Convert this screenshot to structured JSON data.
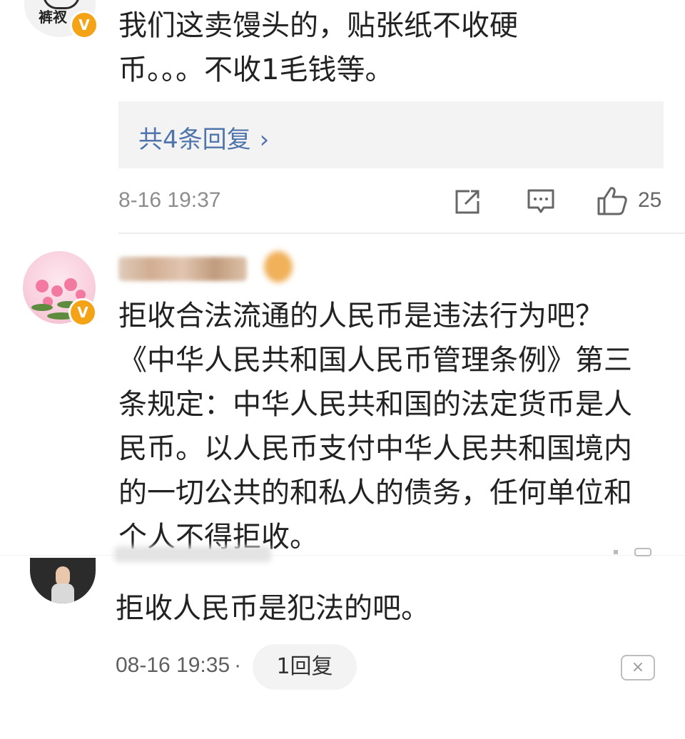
{
  "comment1": {
    "avatar_text": "裤衩",
    "verified": "V",
    "text": "我们这卖馒头的，贴张纸不收硬币。。。不收1毛钱等。",
    "replies_label": "共4条回复",
    "replies_chevron": "›",
    "time": "8-16 19:37",
    "likes": "25",
    "icons": [
      "share-icon",
      "comment-icon",
      "like-icon"
    ]
  },
  "comment2": {
    "verified": "V",
    "text": "拒收合法流通的人民币是违法行为吧？《中华人民共和国人民币管理条例》第三条规定：中华人民共和国的法定货币是人民币。以人民币支付中华人民共和国境内的一切公共的和私人的债务，任何单位和个人不得拒收。"
  },
  "comment3": {
    "text": "拒收人民币是犯法的吧。",
    "time": "08-16 19:35",
    "separator": "·",
    "reply_label": "1回复",
    "close_label": "×"
  },
  "colors": {
    "link": "#4f75ac",
    "verified_badge": "#f4a316",
    "meta": "#8d8d8d",
    "reply_bg": "#f3f3f3"
  }
}
